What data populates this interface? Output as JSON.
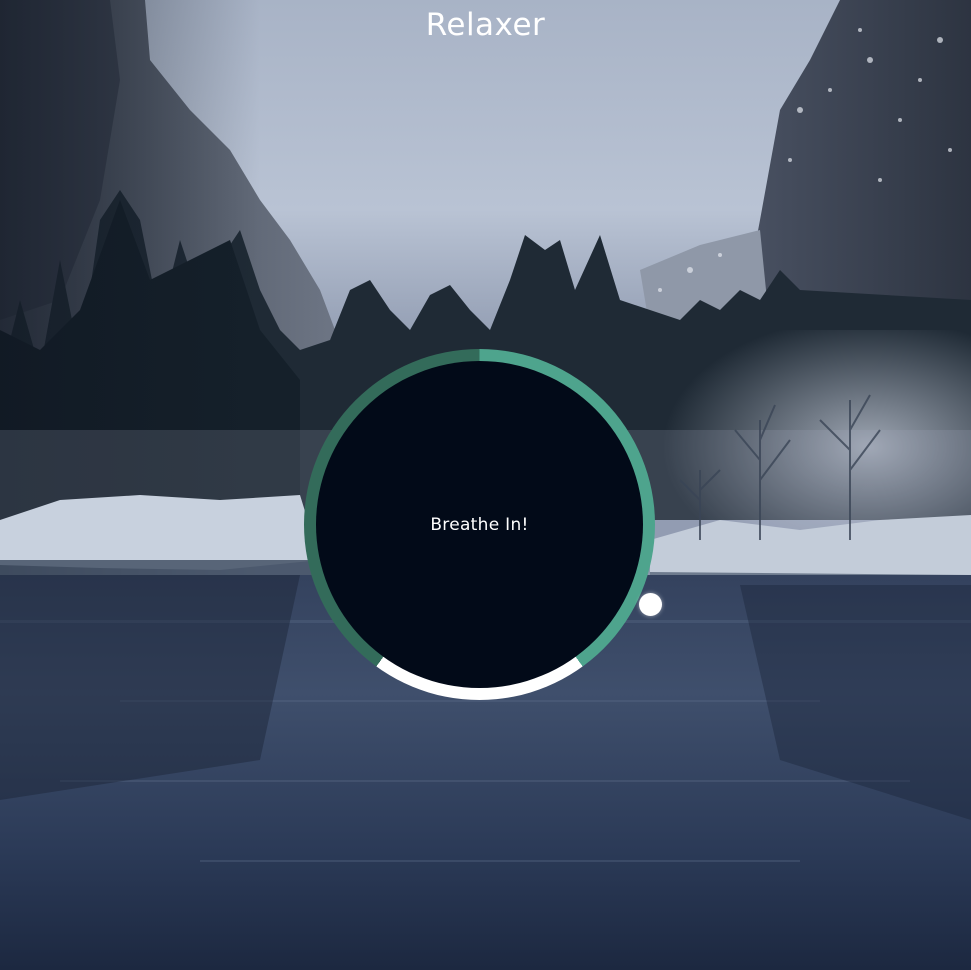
{
  "app": {
    "title": "Relaxer"
  },
  "breathing": {
    "instruction": "Breathe In!",
    "phases": [
      {
        "name": "breathe-in",
        "fraction": 0.4,
        "color": "#4ea48d"
      },
      {
        "name": "hold",
        "fraction": 0.2,
        "color": "#ffffff"
      },
      {
        "name": "breathe-out",
        "fraction": 0.4,
        "color": "#336b5a"
      }
    ],
    "progress_fraction": 0.32
  },
  "colors": {
    "inner_circle": "#020a18",
    "text": "#ffffff",
    "sky": "#b4bfd1",
    "water": "#3b4a66"
  },
  "background": {
    "scene": "misty mountain valley with river"
  }
}
